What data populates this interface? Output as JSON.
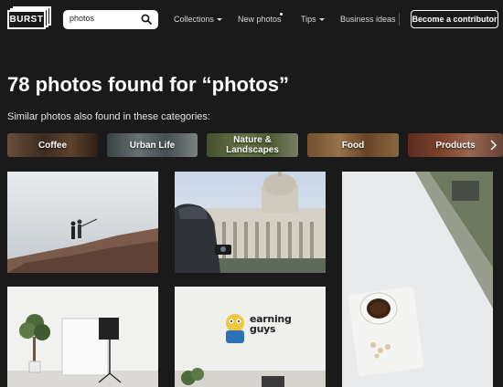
{
  "nav": {
    "logo_text": "BURST",
    "search_value": "photos",
    "links": {
      "collections": "Collections",
      "new_photos": "New photos",
      "tips": "Tips",
      "business_ideas": "Business ideas"
    },
    "contributor_button": "Become a contributor"
  },
  "results": {
    "heading": "78 photos found for “photos”",
    "subheading": "Similar photos also found in these categories:"
  },
  "categories": [
    {
      "label": "Coffee"
    },
    {
      "label": "Urban Life"
    },
    {
      "label": "Nature & Landscapes"
    },
    {
      "label": "Food"
    },
    {
      "label": "Products"
    }
  ],
  "photos": {
    "watermark_text": "earning guys"
  },
  "colors": {
    "background": "#1a1a1a",
    "text": "#ffffff"
  }
}
